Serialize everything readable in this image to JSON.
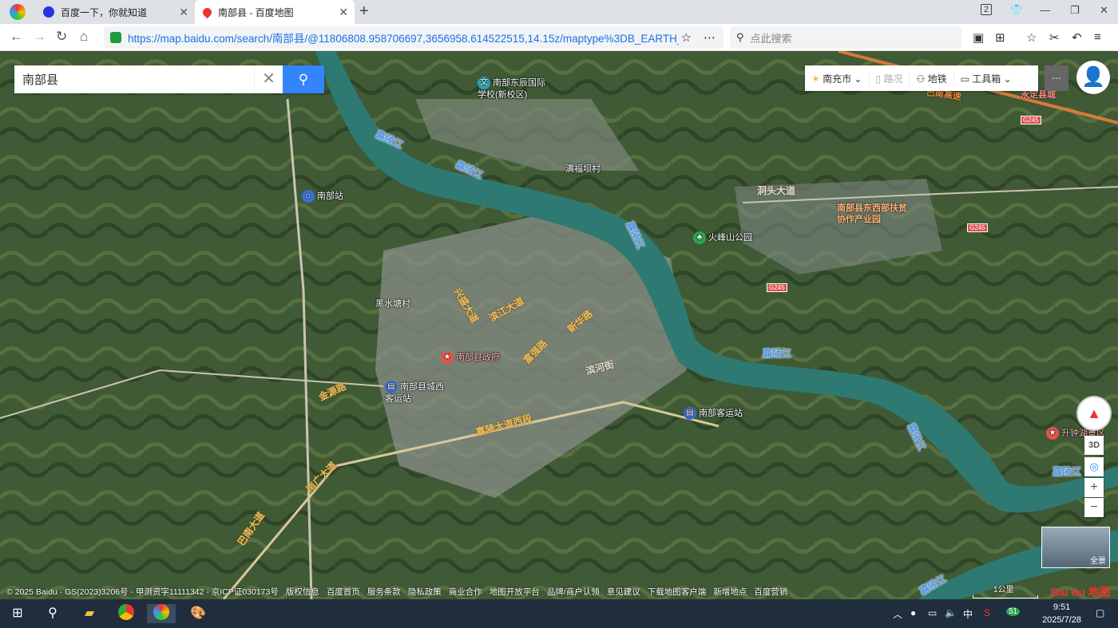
{
  "browser": {
    "tabs": [
      {
        "title": "百度一下，你就知道"
      },
      {
        "title": "南部县 - 百度地图"
      }
    ],
    "tab_count": "2",
    "url": "https://map.baidu.com/search/南部县/@11806808.958706697,3656958.614522515,14.15z/maptype%3DB_EARTH_",
    "search_placeholder": "点此搜索"
  },
  "map": {
    "search_value": "南部县",
    "tools": {
      "city": "南充市",
      "traffic": "路况",
      "subway": "地铁",
      "toolbox": "工具箱"
    },
    "poi": [
      {
        "label": "南部东辰国际学校(新校区)"
      },
      {
        "label": "南部站"
      },
      {
        "label": "满福坝村"
      },
      {
        "label": "火峰山公园"
      },
      {
        "label": "黑水塘村"
      },
      {
        "label": "南部县政府"
      },
      {
        "label": "南部县城西客运站"
      },
      {
        "label": "南部客运站"
      },
      {
        "label": "升钟湖景区"
      }
    ],
    "orange_labels": {
      "industrial_park": "南部县东西部扶贫协作产业园",
      "expressway": "巴南高速",
      "town": "永定县城"
    },
    "roads": {
      "dongxiang": "洞头大道",
      "ninghe": "兴盛大道",
      "xinghe": "滨江大道",
      "xinghua": "新华路",
      "jinyuan": "金源路",
      "fuxing": "富强路",
      "jialing_west": "嘉陵大道西段",
      "nanguang": "南广大道",
      "lead": "巴南大道",
      "yanhe": "滨河街"
    },
    "rivers": {
      "name": "嘉陵江"
    },
    "shields": [
      "G245",
      "G245",
      "G245"
    ],
    "controls": {
      "three_d": "3D",
      "zoom_in": "+",
      "zoom_out": "−",
      "panorama": "全景"
    },
    "scale_label": "1公里",
    "footer": [
      "© 2025 Baidu - GS(2023)3206号 - 甲测资字11111342 - 京ICP证030173号",
      "版权信息",
      "百度首页",
      "服务条款",
      "隐私政策",
      "商业合作",
      "地图开放平台",
      "品牌/商户认领",
      "意见建议",
      "下载地图客户端",
      "新增地点",
      "百度营销"
    ],
    "logo": "Bai du 地图"
  },
  "taskbar": {
    "time": "9:51",
    "date": "2025/7/28",
    "ime": "中",
    "badge": "51"
  }
}
